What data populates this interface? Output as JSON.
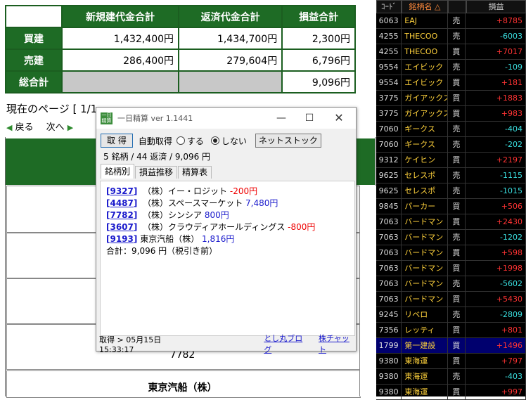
{
  "summary": {
    "headers": [
      "新規建代金合計",
      "返済代金合計",
      "損益合計"
    ],
    "rows": [
      {
        "label": "買建",
        "new": "1,432,400円",
        "repay": "1,434,700円",
        "pl": "2,300円"
      },
      {
        "label": "売建",
        "new": "286,400円",
        "repay": "279,604円",
        "pl": "6,796円"
      },
      {
        "label": "総合計",
        "new": "",
        "repay": "",
        "pl": "9,096円"
      }
    ]
  },
  "page": {
    "current_page": "現在のページ [ 1/1",
    "back": "戻る",
    "next": "次へ",
    "bg_code": "7782",
    "bg_name": "東京汽船（株）"
  },
  "window": {
    "icon_text": "一日精算",
    "title": "一日精算 ver 1.1441",
    "buttons": {
      "minimize": "—",
      "maximize": "☐",
      "close": "✕"
    },
    "fetch_button": "取 得",
    "auto_fetch_label": "自動取得",
    "radio_on": "する",
    "radio_off": "しない",
    "netstock_button": "ネットストック",
    "stats": "5 銘柄 / 44 返済 / 9,096 円",
    "tabs": [
      "銘柄別",
      "損益推移",
      "精算表"
    ],
    "items": [
      {
        "code": "9327",
        "name": "（株）イー・ロジット",
        "pl": "-200円",
        "sign": "neg"
      },
      {
        "code": "4487",
        "name": "（株）スペースマーケット",
        "pl": "7,480円",
        "sign": "pos"
      },
      {
        "code": "7782",
        "name": "（株）シンシア",
        "pl": "800円",
        "sign": "pos"
      },
      {
        "code": "3607",
        "name": "（株）クラウディアホールディングス",
        "pl": "-800円",
        "sign": "neg"
      },
      {
        "code": "9193",
        "name": "東京汽船（株）",
        "pl": "1,816円",
        "sign": "pos"
      }
    ],
    "total": "合計：9,096 円（税引き前）",
    "status": "取得 > 05月15日 15:33:17",
    "link1": "とし丸ブログ",
    "link2": "株チャット"
  },
  "ticker": {
    "headers": [
      "ｺｰﾄﾞ",
      "銘柄名 △",
      "",
      "損益"
    ],
    "rows": [
      {
        "code": "6063",
        "name": "EAJ",
        "side": "売",
        "pl": "+8785"
      },
      {
        "code": "4255",
        "name": "THECOO",
        "side": "売",
        "pl": "-6003"
      },
      {
        "code": "4255",
        "name": "THECOO",
        "side": "買",
        "pl": "+7017"
      },
      {
        "code": "9554",
        "name": "エイビック",
        "side": "売",
        "pl": "-109"
      },
      {
        "code": "9554",
        "name": "エイビック",
        "side": "買",
        "pl": "+181"
      },
      {
        "code": "3775",
        "name": "ガイアックス",
        "side": "買",
        "pl": "+1883"
      },
      {
        "code": "3775",
        "name": "ガイアックス",
        "side": "買",
        "pl": "+983"
      },
      {
        "code": "7060",
        "name": "ギークス",
        "side": "売",
        "pl": "-404"
      },
      {
        "code": "7060",
        "name": "ギークス",
        "side": "売",
        "pl": "-202"
      },
      {
        "code": "9312",
        "name": "ケイヒン",
        "side": "買",
        "pl": "+2197"
      },
      {
        "code": "9625",
        "name": "セレスポ",
        "side": "売",
        "pl": "-1115"
      },
      {
        "code": "9625",
        "name": "セレスポ",
        "side": "売",
        "pl": "-1015"
      },
      {
        "code": "9845",
        "name": "パーカー",
        "side": "買",
        "pl": "+506"
      },
      {
        "code": "7063",
        "name": "バードマン",
        "side": "買",
        "pl": "+2430"
      },
      {
        "code": "7063",
        "name": "バードマン",
        "side": "売",
        "pl": "-1202"
      },
      {
        "code": "7063",
        "name": "バードマン",
        "side": "買",
        "pl": "+598"
      },
      {
        "code": "7063",
        "name": "バードマン",
        "side": "買",
        "pl": "+1998"
      },
      {
        "code": "7063",
        "name": "バードマン",
        "side": "売",
        "pl": "-5602"
      },
      {
        "code": "7063",
        "name": "バードマン",
        "side": "買",
        "pl": "+5430"
      },
      {
        "code": "9245",
        "name": "リベロ",
        "side": "売",
        "pl": "-2809"
      },
      {
        "code": "7356",
        "name": "レッティ",
        "side": "買",
        "pl": "+801"
      },
      {
        "code": "1799",
        "name": "第一建設",
        "side": "買",
        "pl": "+1496"
      },
      {
        "code": "9380",
        "name": "東海運",
        "side": "買",
        "pl": "+797"
      },
      {
        "code": "9380",
        "name": "東海運",
        "side": "売",
        "pl": "-403"
      },
      {
        "code": "9380",
        "name": "東海運",
        "side": "買",
        "pl": "+997"
      }
    ]
  }
}
